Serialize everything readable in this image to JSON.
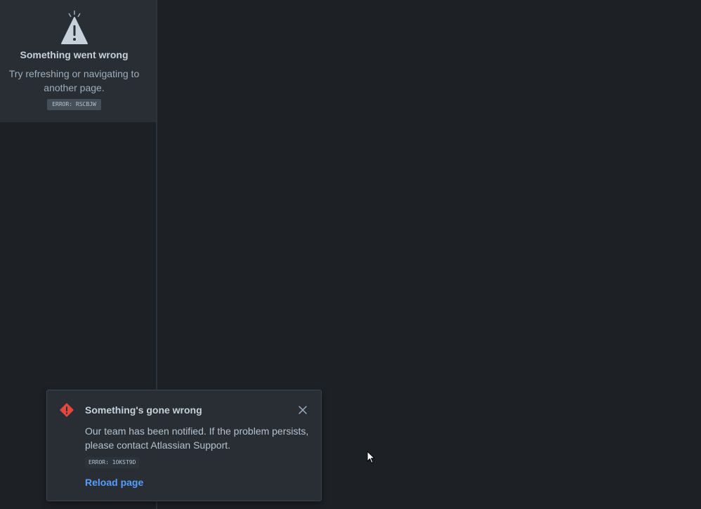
{
  "sidebar": {
    "error_title": "Something went wrong",
    "error_message": "Try refreshing or navigating to another page.",
    "error_code": "ERROR: RSCBJW",
    "icon": "warning-triangle-icon"
  },
  "flag": {
    "title": "Something's gone wrong",
    "message": "Our team has been notified. If the problem persists, please contact Atlassian Support.",
    "error_code": "ERROR: 1OKST9D",
    "action_label": "Reload page",
    "icon": "error-diamond-icon",
    "close_icon": "close-icon"
  },
  "colors": {
    "background": "#1d2125",
    "panel": "#282e33",
    "error_red": "#e2483d",
    "link_blue": "#579dff",
    "text": "#b6c2cf"
  }
}
